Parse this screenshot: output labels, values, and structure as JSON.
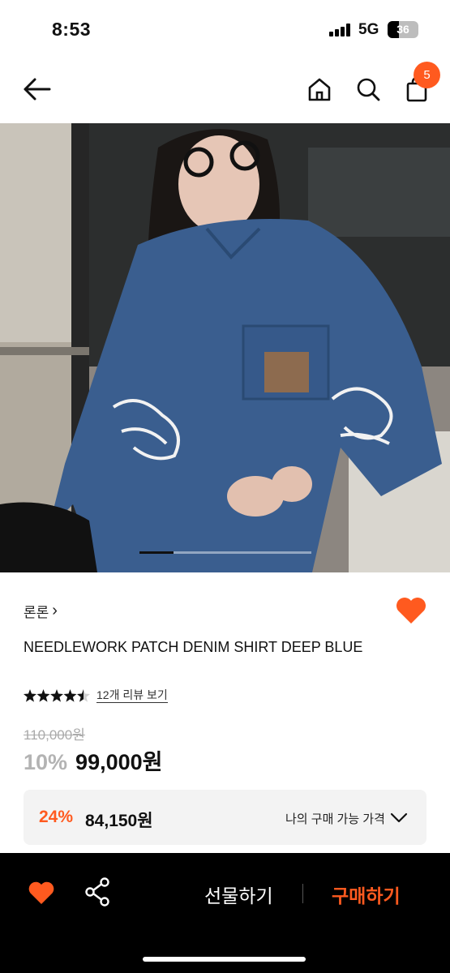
{
  "status_bar": {
    "time": "8:53",
    "network": "5G",
    "battery": "36",
    "battery_level_percent": 36
  },
  "nav": {
    "back_icon": "arrow-left-icon",
    "home_icon": "home-icon",
    "search_icon": "search-icon",
    "cart_icon": "shopping-bag-icon",
    "cart_count": "5"
  },
  "gallery": {
    "image_description_icon": "product-photo",
    "slide_position_fraction": 0.2
  },
  "product": {
    "brand": "론론",
    "brand_chevron": "›",
    "title": "NEEDLEWORK PATCH DENIM SHIRT DEEP BLUE",
    "rating": 4.5,
    "review_link": "12개 리뷰 보기",
    "original_price": "110,000원",
    "discount": "10%",
    "price": "99,000원"
  },
  "my_price": {
    "discount": "24%",
    "price": "84,150원",
    "label": "나의 구매 가능 가격"
  },
  "bottom_bar": {
    "gift_label": "선물하기",
    "buy_label": "구매하기"
  },
  "colors": {
    "accent": "#ff5a1f",
    "bar_background": "#000000",
    "muted_price": "#aaaaaa"
  }
}
